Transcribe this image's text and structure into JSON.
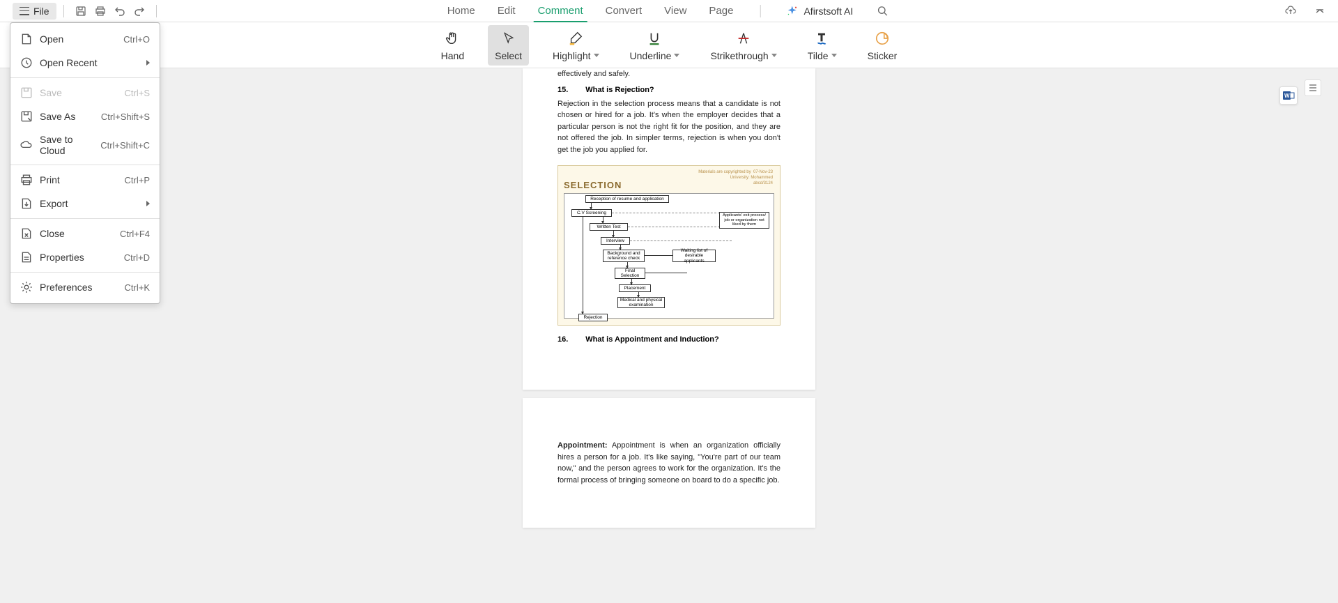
{
  "topbar": {
    "file_label": "File"
  },
  "menus": {
    "home": "Home",
    "edit": "Edit",
    "comment": "Comment",
    "convert": "Convert",
    "view": "View",
    "page": "Page"
  },
  "ai": {
    "label": "Afirstsoft AI"
  },
  "toolbar": {
    "hand": "Hand",
    "select": "Select",
    "highlight": "Highlight",
    "underline": "Underline",
    "strikethrough": "Strikethrough",
    "tilde": "Tilde",
    "sticker": "Sticker"
  },
  "file_menu": {
    "open": {
      "label": "Open",
      "shortcut": "Ctrl+O"
    },
    "open_recent": {
      "label": "Open Recent"
    },
    "save": {
      "label": "Save",
      "shortcut": "Ctrl+S"
    },
    "save_as": {
      "label": "Save As",
      "shortcut": "Ctrl+Shift+S"
    },
    "save_cloud": {
      "label": "Save to Cloud",
      "shortcut": "Ctrl+Shift+C"
    },
    "print": {
      "label": "Print",
      "shortcut": "Ctrl+P"
    },
    "export": {
      "label": "Export"
    },
    "close": {
      "label": "Close",
      "shortcut": "Ctrl+F4"
    },
    "properties": {
      "label": "Properties",
      "shortcut": "Ctrl+D"
    },
    "preferences": {
      "label": "Preferences",
      "shortcut": "Ctrl+K"
    }
  },
  "document": {
    "partial_text_top": "effectively and safely.",
    "q15_num": "15.",
    "q15_heading": "What is Rejection?",
    "q15_body": "Rejection in the selection process means that a candidate is not chosen or hired for a job. It's when the employer decides that a particular person is not the right fit for the position, and they are not offered the job. In simpler terms, rejection is when you don't get the job you applied for.",
    "q16_num": "16.",
    "q16_heading": "What is Appointment and Induction?",
    "appointment_label": "Appointment:",
    "appointment_body": " Appointment is when an organization officially hires a person for a job. It's like saying, \"You're part of our team now,\" and the person agrees to work for the organization. It's the formal process of bringing someone on board to do a specific job.",
    "figure": {
      "header_right1": "Materials are copyrighted by",
      "header_right2": "University: Mohammed",
      "header_right3": "abcd/3124",
      "header_date": "07-Nov-23",
      "title": "SELECTION",
      "boxes": {
        "reception": "Reception of resume and application",
        "cv": "C.V Screening",
        "written": "Written Test",
        "interview": "Interview",
        "background": "Background and reference check",
        "final": "Final Selection",
        "placement": "Placement",
        "medical": "Medical and physical examination",
        "rejection": "Rejection",
        "waiting": "Waiting list of desirable applicants",
        "exit": "Applicants' exit process/ job or organization not liked by them"
      }
    }
  }
}
